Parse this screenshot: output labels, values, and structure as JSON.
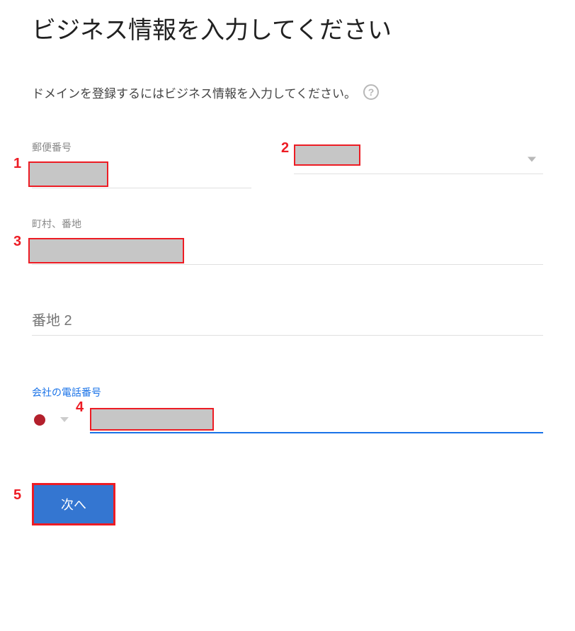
{
  "title": "ビジネス情報を入力してください",
  "description": "ドメインを登録するにはビジネス情報を入力してください。",
  "fields": {
    "postal": {
      "label": "郵便番号"
    },
    "prefecture": {
      "label": ""
    },
    "town": {
      "label": "町村、番地"
    },
    "address2": {
      "placeholder": "番地 2"
    },
    "phone": {
      "label": "会社の電話番号"
    }
  },
  "buttons": {
    "next": "次へ"
  },
  "annotations": {
    "a1": "1",
    "a2": "2",
    "a3": "3",
    "a4": "4",
    "a5": "5"
  },
  "help_icon_text": "?"
}
